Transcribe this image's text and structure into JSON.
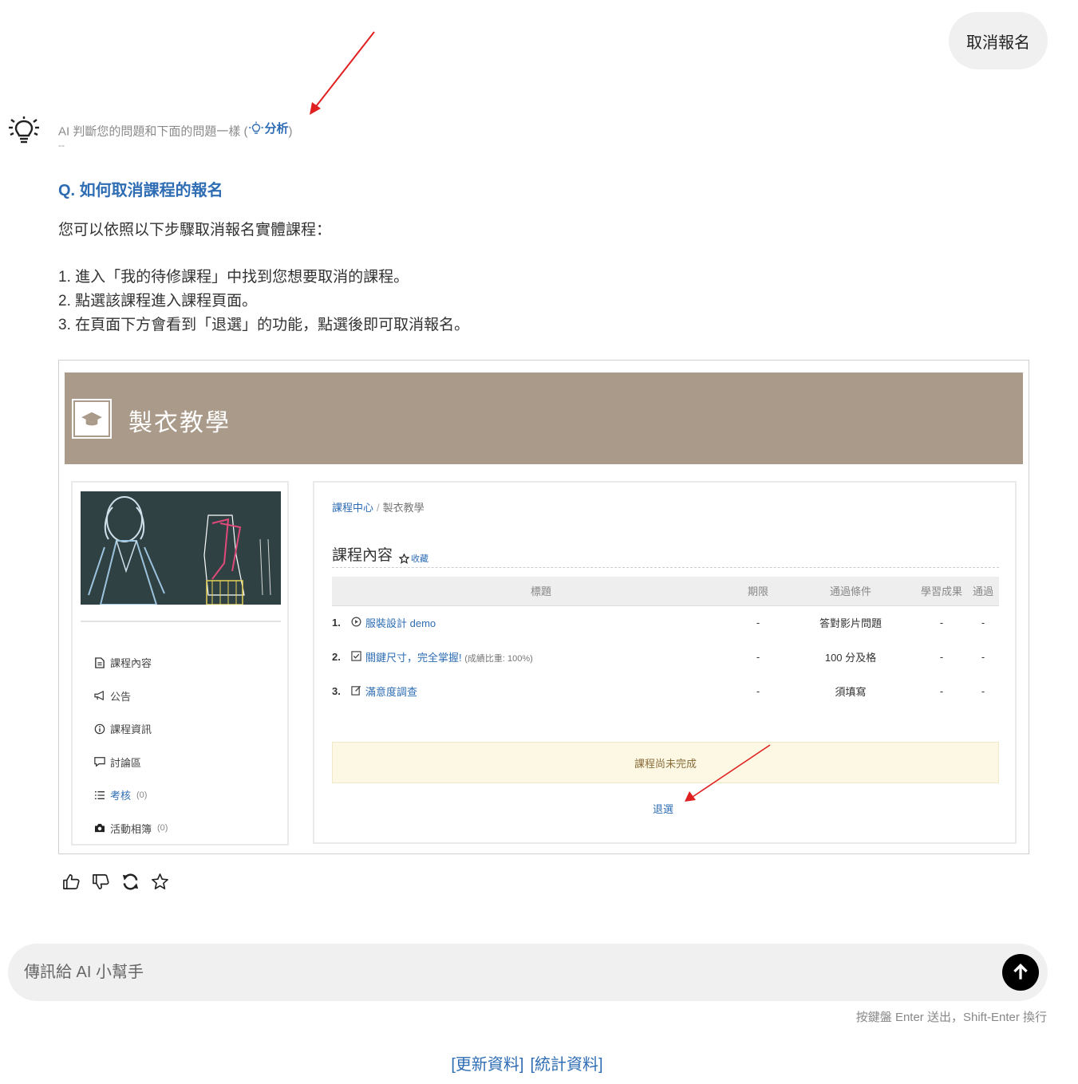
{
  "user_message": "取消報名",
  "ai": {
    "note_prefix": "AI 判斷您的問題和下面的問題一樣 (",
    "analyze_label": "分析",
    "note_suffix": ")",
    "dash": "--"
  },
  "answer": {
    "question": "Q. 如何取消課程的報名",
    "intro": "您可以依照以下步驟取消報名實體課程：",
    "steps": [
      "1. 進入「我的待修課程」中找到您想要取消的課程。",
      "2. 點選該課程進入課程頁面。",
      "3. 在頁面下方會看到「退選」的功能，點選後即可取消報名。"
    ]
  },
  "screenshot": {
    "course_title": "製衣教學",
    "breadcrumb": {
      "home": "課程中心",
      "sep": "/",
      "current": "製衣教學"
    },
    "content_heading": "課程內容",
    "favorite_label": "收藏",
    "menu": [
      {
        "label": "課程內容",
        "icon": "file-icon",
        "count": ""
      },
      {
        "label": "公告",
        "icon": "megaphone-icon",
        "count": ""
      },
      {
        "label": "課程資訊",
        "icon": "info-icon",
        "count": ""
      },
      {
        "label": "討論區",
        "icon": "comment-icon",
        "count": ""
      },
      {
        "label": "考核",
        "icon": "list-icon",
        "count": "(0)"
      },
      {
        "label": "活動相簿",
        "icon": "camera-icon",
        "count": "(0)"
      }
    ],
    "table": {
      "headers": [
        "標題",
        "期限",
        "通過條件",
        "學習成果",
        "通過"
      ],
      "rows": [
        {
          "num": "1.",
          "icon": "play-icon",
          "title": "服裝設計 demo",
          "note": "",
          "deadline": "-",
          "condition": "答對影片問題",
          "result": "-",
          "passed": "-"
        },
        {
          "num": "2.",
          "icon": "checkbox-icon",
          "title": "關鍵尺寸，完全掌握!",
          "note": "(成績比重: 100%)",
          "deadline": "-",
          "condition": "100 分及格",
          "result": "-",
          "passed": "-"
        },
        {
          "num": "3.",
          "icon": "survey-icon",
          "title": "滿意度調查",
          "note": "",
          "deadline": "-",
          "condition": "須填寫",
          "result": "-",
          "passed": "-"
        }
      ]
    },
    "status": "課程尚未完成",
    "withdraw": "退選"
  },
  "composer": {
    "placeholder": "傳訊給 AI 小幫手",
    "hint": "按鍵盤 Enter 送出，Shift-Enter 換行"
  },
  "footer": {
    "update_link": "[更新資料]",
    "stats_link": "[統計資料]"
  },
  "colors": {
    "accent": "#2e6db4",
    "banner": "#a99a89",
    "annotation_arrow": "#e02020",
    "warning_bg": "#fcf8e3"
  }
}
